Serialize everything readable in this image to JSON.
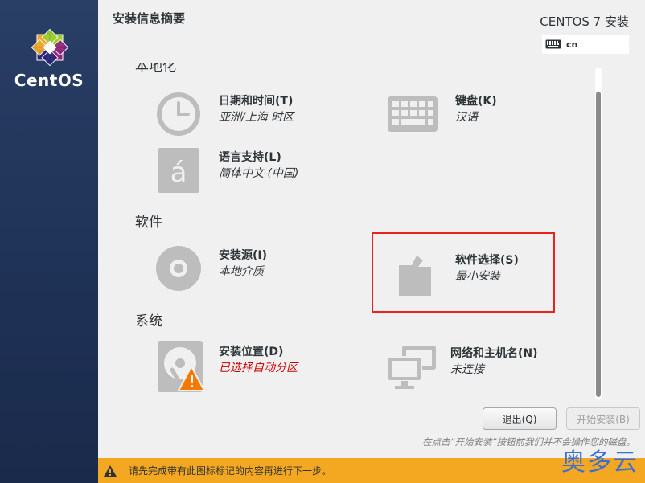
{
  "sidebar": {
    "logo_text": "CentOS"
  },
  "header": {
    "page_title": "安装信息摘要",
    "product_title": "CENTOS 7 安装",
    "keyboard_layout": "cn"
  },
  "categories": {
    "localization": "本地化",
    "software": "软件",
    "system": "系统"
  },
  "spokes": {
    "datetime": {
      "title": "日期和时间(T)",
      "status": "亚洲/上海 时区",
      "icon": "clock-icon"
    },
    "keyboard": {
      "title": "键盘(K)",
      "status": "汉语",
      "icon": "keyboard-icon"
    },
    "language": {
      "title": "语言支持(L)",
      "status": "简体中文 (中国)",
      "icon": "language-icon"
    },
    "source": {
      "title": "安装源(I)",
      "status": "本地介质",
      "icon": "disc-icon"
    },
    "software": {
      "title": "软件选择(S)",
      "status": "最小安装",
      "icon": "package-icon"
    },
    "destination": {
      "title": "安装位置(D)",
      "status": "已选择自动分区",
      "icon": "harddisk-warning-icon"
    },
    "network": {
      "title": "网络和主机名(N)",
      "status": "未连接",
      "icon": "network-icon"
    }
  },
  "buttons": {
    "quit": "退出(Q)",
    "begin": "开始安装(B)"
  },
  "hint": "在点击“开始安装”按钮前我们并不会操作您的磁盘。",
  "warning": "请先完成带有此图标标记的内容再进行下一步。",
  "watermark": "奥多云",
  "colors": {
    "sidebar": "#1f3257",
    "warning_bar": "#f4a720",
    "warning_status": "#cc0000",
    "highlight": "#e8231f"
  }
}
